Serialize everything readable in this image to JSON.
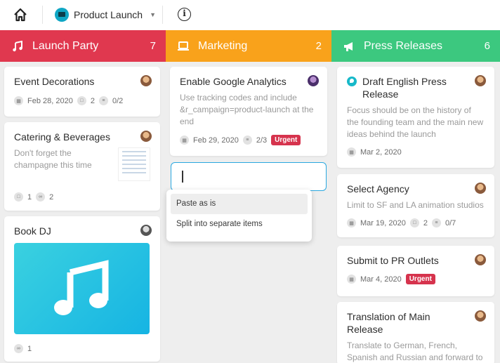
{
  "topbar": {
    "project_name": "Product Launch",
    "icons": [
      "home-icon",
      "info-icon",
      "chevron-down-icon",
      "laptop-icon"
    ]
  },
  "columns": [
    {
      "title": "Launch Party",
      "count": "7",
      "color": "#e0384f",
      "icon": "music-note-icon",
      "cards": [
        {
          "title": "Event Decorations",
          "date": "Feb 28, 2020",
          "comments": "2",
          "checklist": "0/2"
        },
        {
          "title": "Catering & Beverages",
          "desc": "Don't forget the champagne this time",
          "comments": "1",
          "attachments": "2"
        },
        {
          "title": "Book DJ",
          "attachments": "1"
        }
      ]
    },
    {
      "title": "Marketing",
      "count": "2",
      "color": "#f9a21b",
      "icon": "laptop-icon",
      "cards": [
        {
          "title": "Enable Google Analytics",
          "desc": "Use tracking codes and include &r_campaign=product-launch at the end",
          "date": "Feb 29, 2020",
          "checklist": "2/3",
          "badge": "Urgent"
        }
      ]
    },
    {
      "title": "Press Releases",
      "count": "6",
      "color": "#3cc87f",
      "icon": "megaphone-icon",
      "cards": [
        {
          "title": "Draft English Press Release",
          "desc": "Focus should be on the history of the founding team and the main new ideas behind the launch",
          "date": "Mar 2, 2020"
        },
        {
          "title": "Select Agency",
          "desc": "Limit to SF and LA animation studios",
          "date": "Mar 19, 2020",
          "comments": "2",
          "checklist": "0/7"
        },
        {
          "title": "Submit to PR Outlets",
          "date": "Mar 4, 2020",
          "badge": "Urgent"
        },
        {
          "title": "Translation of Main Release",
          "desc": "Translate to German, French, Spanish and Russian and forward to our local agencies"
        }
      ]
    }
  ],
  "context_menu": {
    "items": [
      "Paste as is",
      "Split into separate items"
    ]
  }
}
